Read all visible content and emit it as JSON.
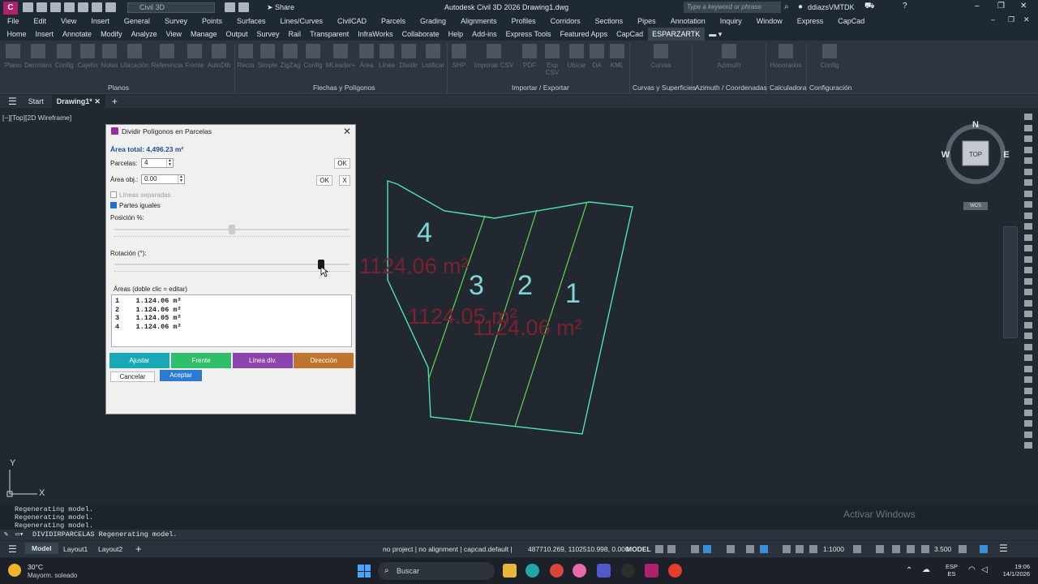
{
  "titlebar": {
    "workspace": "Civil 3D",
    "share": "Share",
    "title": "Autodesk Civil 3D 2026   Drawing1.dwg",
    "search_placeholder": "Type a keyword or phrase",
    "user": "ddiazsVMTDK"
  },
  "menubar": [
    "File",
    "Edit",
    "View",
    "Insert",
    "General",
    "Survey",
    "Points",
    "Surfaces",
    "Lines/Curves",
    "CivilCAD",
    "Parcels",
    "Grading",
    "Alignments",
    "Profiles",
    "Corridors",
    "Sections",
    "Pipes",
    "Annotation",
    "Inquiry",
    "Window",
    "Express",
    "CapCad"
  ],
  "ribbon_tabs": [
    "Home",
    "Insert",
    "Annotate",
    "Modify",
    "Analyze",
    "View",
    "Manage",
    "Output",
    "Survey",
    "Rail",
    "Transparent",
    "InfraWorks",
    "Collaborate",
    "Help",
    "Add-ins",
    "Express Tools",
    "Featured Apps",
    "CapCad",
    "ESPARZARTK"
  ],
  "ribbon": {
    "buttons": [
      "Plano",
      "Derrotero",
      "Config",
      "Cajetín",
      "Notas",
      "Ubicación",
      "Referencia",
      "Frente",
      "AutoDib",
      "Recta",
      "Simple",
      "ZigZag",
      "Config",
      "MLeader+",
      "Área",
      "Línea",
      "Dividir",
      "Lotificar",
      "SHP",
      "Importar CSV",
      "PDF",
      "Exp CSV",
      "Ubicar",
      "DA",
      "KML",
      "Curvas",
      "Azimuth",
      "Honorarios",
      "Config"
    ],
    "panels": [
      "Planos",
      "Flechas y Polígonos",
      "Importar / Exportar",
      "Curvas y Superficies",
      "Azimuth / Coordenadas",
      "Calculadora",
      "Configuración"
    ]
  },
  "filetabs": {
    "start": "Start",
    "drawing": "Drawing1*"
  },
  "viewport_label": "[−][Top][2D Wireframe]",
  "viewcube": {
    "n": "N",
    "s": "S",
    "e": "E",
    "w": "W",
    "face": "TOP",
    "ucs": "WCS"
  },
  "drawing": {
    "parcel_labels": [
      "4",
      "3",
      "2",
      "1"
    ],
    "area_texts": [
      "1124.06 m²",
      "1124.05 m²",
      "1124.06 m²"
    ],
    "ucs_y": "Y",
    "ucs_x": "X"
  },
  "dialog": {
    "title": "Dividir Polígonos en Parcelas",
    "area_total": "Área total: 4,496.23 m²",
    "parcelas_label": "Parcelas:",
    "parcelas_value": "4",
    "area_obj_label": "Área obj.:",
    "area_obj_value": "0.00",
    "ok": "OK",
    "x": "X",
    "lineas_separadas": "Líneas separadas",
    "lineas_separadas_checked": false,
    "partes_iguales": "Partes iguales",
    "partes_iguales_checked": true,
    "posicion_label": "Posición %:",
    "posicion_value": 0.5,
    "rotacion_label": "Rotación (°):",
    "rotacion_value": 0.88,
    "areas_header": "Áreas (doble clic = editar)",
    "areas": [
      {
        "n": "1",
        "area": "1.124.06 m²"
      },
      {
        "n": "2",
        "area": "1.124.06 m²"
      },
      {
        "n": "3",
        "area": "1.124.05 m²"
      },
      {
        "n": "4",
        "area": "1.124.06 m²"
      }
    ],
    "btn_ajustar": "Ajustar",
    "btn_frente": "Frente",
    "btn_linea": "Línea div.",
    "btn_direccion": "Dirección",
    "btn_cancelar": "Cancelar",
    "btn_aceptar": "Aceptar",
    "colors": {
      "ajustar": "#19a9b6",
      "frente": "#2fbf6a",
      "linea": "#8e44ad",
      "direccion": "#c0752e"
    }
  },
  "command": {
    "history": [
      "Regenerating model.",
      "Regenerating model.",
      "Regenerating model."
    ],
    "current": "DIVIDIRPARCELAS Regenerating model."
  },
  "watermark": "Activar Windows",
  "statusbar": {
    "model_tab": "Model",
    "layout1": "Layout1",
    "layout2": "Layout2",
    "project": "no project | no alignment | capcad.default |",
    "coords": "487710.269, 1102510.998, 0.000",
    "space": "MODEL",
    "scale": "1:1000",
    "value": "3.500"
  },
  "taskbar": {
    "temp": "30°C",
    "weather": "Mayorm. soleado",
    "search": "Buscar",
    "lang1": "ESP",
    "lang2": "ES",
    "time": "19:06",
    "date": "14/1/2026"
  }
}
